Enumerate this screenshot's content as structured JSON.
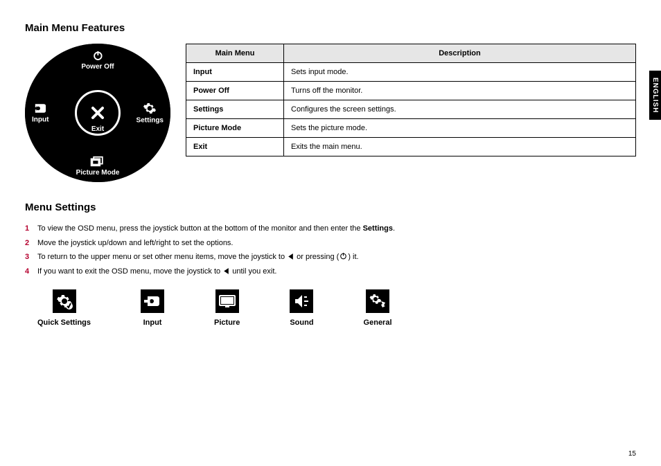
{
  "sideTab": "ENGLISH",
  "pageNumber": "15",
  "section1": {
    "title": "Main Menu Features",
    "dial": {
      "top": {
        "label": "Power Off",
        "iconName": "power-icon"
      },
      "right": {
        "label": "Settings",
        "iconName": "gear-icon"
      },
      "bottom": {
        "label": "Picture Mode",
        "iconName": "picture-mode-icon"
      },
      "left": {
        "label": "Input",
        "iconName": "input-icon"
      },
      "center": {
        "label": "Exit",
        "iconName": "close-icon"
      }
    },
    "table": {
      "headers": [
        "Main Menu",
        "Description"
      ],
      "rows": [
        {
          "name": "Input",
          "desc": "Sets input mode."
        },
        {
          "name": "Power Off",
          "desc": "Turns off the monitor."
        },
        {
          "name": "Settings",
          "desc": "Configures the screen settings."
        },
        {
          "name": "Picture Mode",
          "desc": "Sets the picture mode."
        },
        {
          "name": "Exit",
          "desc": "Exits the main menu."
        }
      ]
    }
  },
  "section2": {
    "title": "Menu Settings",
    "steps": [
      {
        "n": "1",
        "pre": "To view the OSD menu, press the joystick button at the bottom of the monitor and then enter the ",
        "bold": "Settings",
        "post": "."
      },
      {
        "n": "2",
        "pre": "Move the joystick up/down and left/right to set the options.",
        "bold": "",
        "post": ""
      },
      {
        "n": "3",
        "pre": "To return to the upper menu or set other menu items, move the joystick to ",
        "icon1": "triangle-left-icon",
        "mid": " or pressing (",
        "icon2": "joystick-press-icon",
        "post": ") it."
      },
      {
        "n": "4",
        "pre": "If you want to exit the OSD menu, move the joystick to ",
        "icon1": "triangle-left-icon",
        "post": " until you exit."
      }
    ],
    "iconRow": [
      {
        "label": "Quick Settings",
        "iconName": "quick-settings-icon"
      },
      {
        "label": "Input",
        "iconName": "input-icon"
      },
      {
        "label": "Picture",
        "iconName": "picture-icon"
      },
      {
        "label": "Sound",
        "iconName": "sound-icon"
      },
      {
        "label": "General",
        "iconName": "general-icon"
      }
    ]
  }
}
